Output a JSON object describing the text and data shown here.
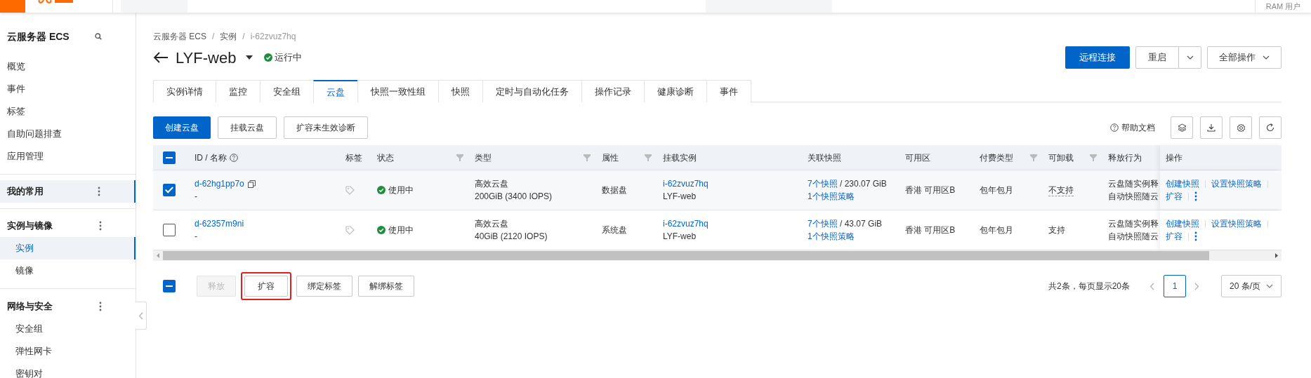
{
  "top_bar": {
    "account": "RAM 用户"
  },
  "sidebar": {
    "title": "云服务器 ECS",
    "items": [
      {
        "label": "概览",
        "selected": false
      },
      {
        "label": "事件",
        "selected": false
      },
      {
        "label": "标签",
        "selected": false
      },
      {
        "label": "自助问题排查",
        "selected": false
      },
      {
        "label": "应用管理",
        "selected": false
      }
    ],
    "groups": [
      {
        "label": "我的常用",
        "selected": true
      },
      {
        "label": "实例与镜像",
        "selected": false,
        "children": [
          {
            "label": "实例",
            "selected": true
          },
          {
            "label": "镜像",
            "selected": false
          }
        ]
      },
      {
        "label": "网络与安全",
        "selected": false,
        "children": [
          {
            "label": "安全组",
            "selected": false
          },
          {
            "label": "弹性网卡",
            "selected": false
          },
          {
            "label": "密钥对",
            "selected": false
          }
        ]
      }
    ]
  },
  "breadcrumb": [
    {
      "text": "云服务器 ECS",
      "kind": "link"
    },
    {
      "text": "/",
      "kind": "separator"
    },
    {
      "text": "实例",
      "kind": "link"
    },
    {
      "text": "/",
      "kind": "separator"
    },
    {
      "text": "i-62zvuz7hq",
      "kind": "current"
    }
  ],
  "header": {
    "title": "LYF-web",
    "status": "运行中",
    "actions": [
      {
        "label": "远程连接",
        "kind": "primary"
      },
      {
        "label": "重启",
        "kind": "split"
      },
      {
        "label": "全部操作",
        "kind": "dropdown"
      }
    ]
  },
  "tabs": [
    {
      "label": "实例详情",
      "selected": false
    },
    {
      "label": "监控",
      "selected": false
    },
    {
      "label": "安全组",
      "selected": false
    },
    {
      "label": "云盘",
      "selected": true
    },
    {
      "label": "快照一致性组",
      "selected": false
    },
    {
      "label": "快照",
      "selected": false
    },
    {
      "label": "定时与自动化任务",
      "selected": false
    },
    {
      "label": "操作记录",
      "selected": false
    },
    {
      "label": "健康诊断",
      "selected": false
    },
    {
      "label": "事件",
      "selected": false
    }
  ],
  "toolbar": {
    "buttons": [
      {
        "label": "创建云盘",
        "kind": "primary"
      },
      {
        "label": "挂载云盘",
        "kind": "normal"
      },
      {
        "label": "扩容未生效诊断",
        "kind": "normal"
      }
    ],
    "help": "帮助文档"
  },
  "table": {
    "select_all": {
      "indeterminate": true
    },
    "columns": [
      {
        "label": "ID / 名称",
        "help": true,
        "filter": false
      },
      {
        "label": "标签",
        "help": false,
        "filter": false
      },
      {
        "label": "状态",
        "help": false,
        "filter": true
      },
      {
        "label": "类型",
        "help": false,
        "filter": true
      },
      {
        "label": "属性",
        "help": false,
        "filter": true
      },
      {
        "label": "挂载实例",
        "help": false,
        "filter": false
      },
      {
        "label": "关联快照",
        "help": false,
        "filter": false
      },
      {
        "label": "可用区",
        "help": false,
        "filter": false
      },
      {
        "label": "付费类型",
        "help": false,
        "filter": true
      },
      {
        "label": "可卸载",
        "help": false,
        "filter": true
      },
      {
        "label": "释放行为",
        "help": false,
        "filter": false
      },
      {
        "label": "操作",
        "help": false,
        "filter": false
      }
    ],
    "rows": [
      {
        "selected": true,
        "id": "d-62hg1pp7o",
        "copy_icon": true,
        "name": "-",
        "status": "使用中",
        "type": "高效云盘",
        "spec": "200GiB (3400 IOPS)",
        "attribute": "数据盘",
        "instance_id": "i-62zvuz7hq",
        "instance_name": "LYF-web",
        "snapshots": "7个快照",
        "snapshot_size": " / 230.07 GiB",
        "snapshot_policy": "1个快照策略",
        "zone": "香港 可用区B",
        "billing": "包年包月",
        "detachable": "不支持",
        "detachable_hint": true,
        "release": [
          "云盘随实例释",
          "自动快照随云"
        ],
        "actions": [
          "创建快照",
          "设置快照策略",
          "扩容"
        ]
      },
      {
        "selected": false,
        "id": "d-62357m9ni",
        "copy_icon": false,
        "name": "-",
        "status": "使用中",
        "type": "高效云盘",
        "spec": "40GiB (2120 IOPS)",
        "attribute": "系统盘",
        "instance_id": "i-62zvuz7hq",
        "instance_name": "LYF-web",
        "snapshots": "7个快照",
        "snapshot_size": " / 43.07 GiB",
        "snapshot_policy": "1个快照策略",
        "zone": "香港 可用区B",
        "billing": "包年包月",
        "detachable": "支持",
        "detachable_hint": false,
        "release": [
          "云盘随实例释",
          "自动快照随云"
        ],
        "actions": [
          "创建快照",
          "设置快照策略",
          "扩容"
        ]
      }
    ]
  },
  "bulk_actions": {
    "select_all": {
      "indeterminate": true
    },
    "buttons": [
      {
        "label": "释放",
        "disabled": true,
        "highlighted": false
      },
      {
        "label": "扩容",
        "disabled": false,
        "highlighted": true
      },
      {
        "label": "绑定标签",
        "disabled": false,
        "highlighted": false
      },
      {
        "label": "解绑标签",
        "disabled": false,
        "highlighted": false
      }
    ]
  },
  "pagination": {
    "summary": "共2条，每页显示20条",
    "pages": [
      {
        "label": "1",
        "selected": true
      }
    ],
    "page_size": "20 条/页"
  }
}
